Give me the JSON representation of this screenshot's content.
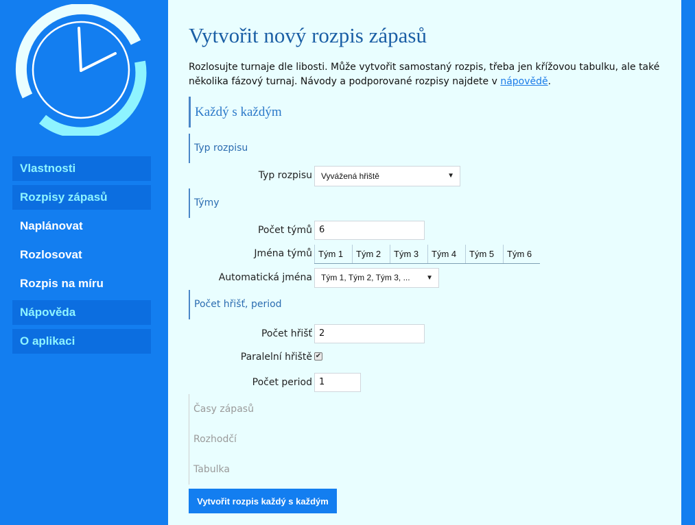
{
  "colors": {
    "sidebar_bg": "#137ef0",
    "main_bg": "#e9feff",
    "nav_boxed_bg": "#0c6ee0",
    "nav_boxed_text": "#8ef4ff",
    "title": "#1b5fa5",
    "link": "#1a7be8"
  },
  "logo": {
    "icon": "clock-icon"
  },
  "sidebar": {
    "items": [
      {
        "label": "Vlastnosti"
      },
      {
        "label": "Rozpisy zápasů"
      },
      {
        "label": "Naplánovat"
      },
      {
        "label": "Rozlosovat"
      },
      {
        "label": "Rozpis na míru"
      },
      {
        "label": "Nápověda"
      },
      {
        "label": "O aplikaci"
      }
    ]
  },
  "main": {
    "title": "Vytvořit nový rozpis zápasů",
    "intro_text": "Rozlosujte turnaje dle libosti. Může vytvořit samostaný rozpis, třeba jen křížovou tabulku, ale také několika fázový turnaj. Návody a podporované rozpisy najdete v ",
    "intro_link": "nápovědě",
    "intro_end": ".",
    "section_main": "Každý s každým",
    "section_type": "Typ rozpisu",
    "type_label": "Typ rozpisu",
    "type_value": "Vyvážená hřiště",
    "section_teams": "Týmy",
    "team_count_label": "Počet týmů",
    "team_count_value": "6",
    "team_names_label": "Jména týmů",
    "team_names": [
      "Tým 1",
      "Tým 2",
      "Tým 3",
      "Tým 4",
      "Tým 5",
      "Tým 6"
    ],
    "auto_names_label": "Automatická jména",
    "auto_names_value": "Tým 1, Tým 2, Tým 3, ...",
    "section_fields": "Počet hřišť, period",
    "field_count_label": "Počet hřišť",
    "field_count_value": "2",
    "parallel_label": "Paralelní hřiště",
    "parallel_checked": true,
    "period_count_label": "Počet period",
    "period_count_value": "1",
    "section_times": "Časy zápasů",
    "section_referees": "Rozhodčí",
    "section_table": "Tabulka",
    "submit_label": "Vytvořit rozpis každý s každým"
  }
}
